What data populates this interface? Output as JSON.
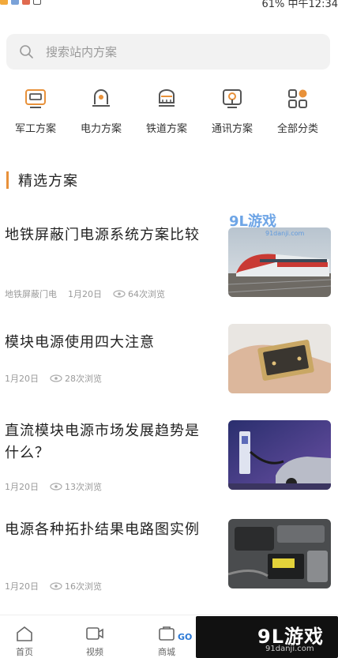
{
  "status": {
    "right_text": "61% 中午12:34"
  },
  "search": {
    "placeholder": "搜索站内方案"
  },
  "categories": [
    {
      "label": "军工方案",
      "icon": "military-icon"
    },
    {
      "label": "电力方案",
      "icon": "power-icon"
    },
    {
      "label": "铁道方案",
      "icon": "railway-icon"
    },
    {
      "label": "通讯方案",
      "icon": "telecom-icon"
    },
    {
      "label": "全部分类",
      "icon": "all-categories-icon"
    }
  ],
  "section": {
    "title": "精选方案"
  },
  "articles": [
    {
      "title": "地铁屏蔽门电源系统方案比较",
      "tag": "地铁屏蔽门电",
      "date": "1月20日",
      "views": "64次浏览",
      "thumb": "high-speed-train"
    },
    {
      "title": "模块电源使用四大注意",
      "tag": "",
      "date": "1月20日",
      "views": "28次浏览",
      "thumb": "power-module-in-hand"
    },
    {
      "title": "直流模块电源市场发展趋势是什么？",
      "tag": "",
      "date": "1月20日",
      "views": "13次浏览",
      "thumb": "ev-charging"
    },
    {
      "title": "电源各种拓扑结果电路图实例",
      "tag": "",
      "date": "1月20日",
      "views": "16次浏览",
      "thumb": "car-engine-battery"
    }
  ],
  "bottom_nav": [
    {
      "label": "首页",
      "icon": "home-icon"
    },
    {
      "label": "视频",
      "icon": "video-icon"
    },
    {
      "label": "商城",
      "icon": "shop-icon"
    }
  ],
  "watermarks": {
    "brand": "9L游戏",
    "site": "91danji.com",
    "go": "GO"
  },
  "colors": {
    "accent": "#e8913a",
    "icon_stroke": "#555555",
    "meta": "#9a9a9a"
  }
}
